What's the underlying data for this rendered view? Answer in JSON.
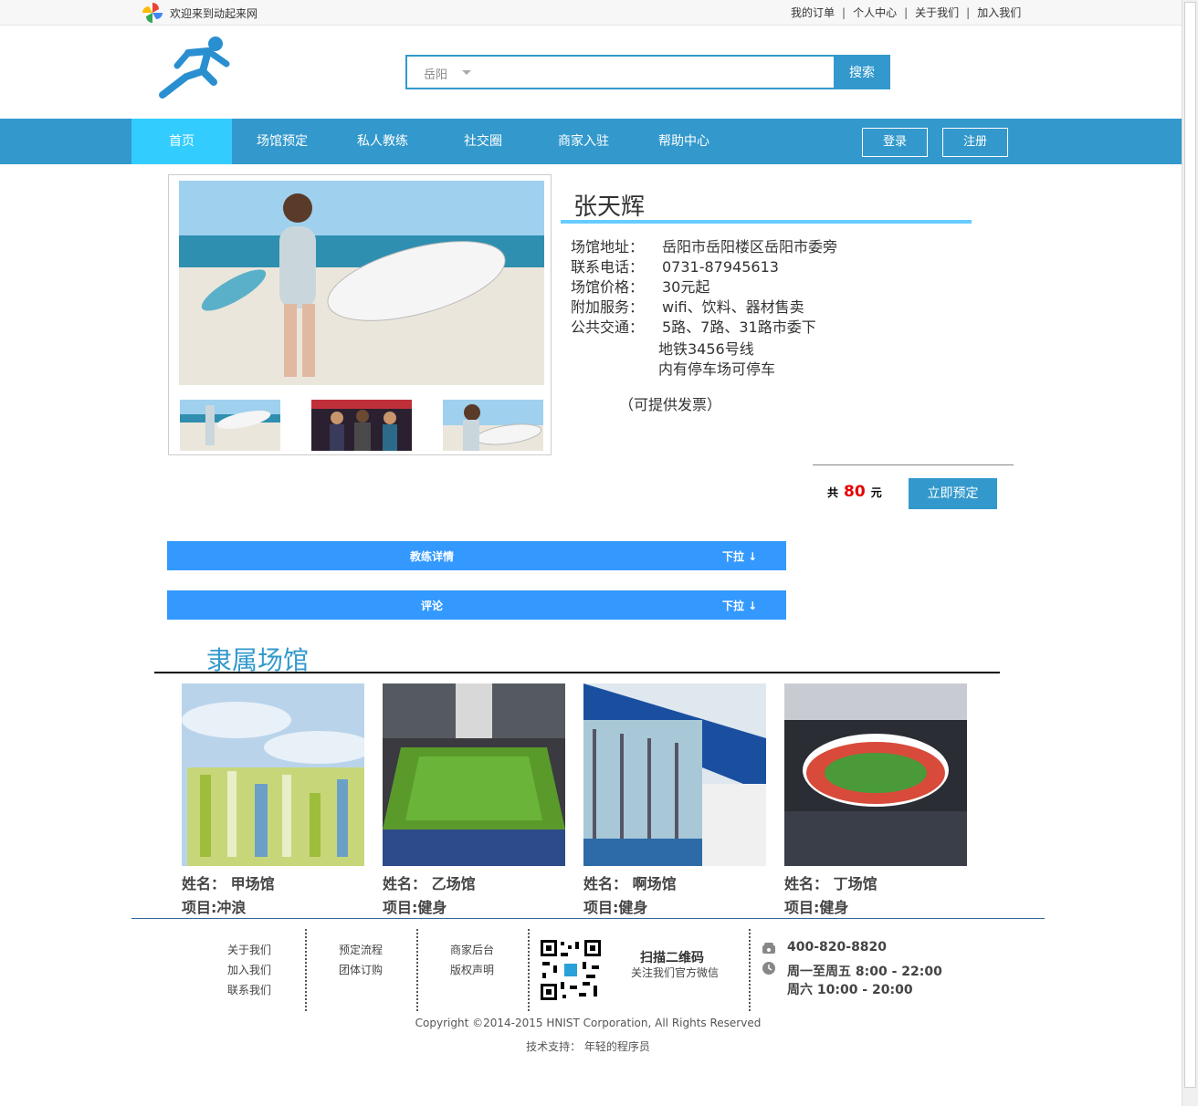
{
  "topbar": {
    "welcome": "欢迎来到动起来网",
    "links": [
      "我的订单",
      "个人中心",
      "关于我们",
      "加入我们"
    ],
    "separator": "|"
  },
  "search": {
    "city": "岳阳",
    "placeholder": "",
    "button": "搜索"
  },
  "nav": {
    "items": [
      "首页",
      "场馆预定",
      "私人教练",
      "社交圈",
      "商家入驻",
      "帮助中心"
    ],
    "login": "登录",
    "register": "注册"
  },
  "coach": {
    "name": "张天辉",
    "rows": [
      {
        "k": "场馆地址：",
        "v": "岳阳市岳阳楼区岳阳市委旁"
      },
      {
        "k": "联系电话：",
        "v": "0731-87945613"
      },
      {
        "k": "场馆价格：",
        "v": "30元起"
      },
      {
        "k": "附加服务：",
        "v": "wifi、饮料、器材售卖"
      },
      {
        "k": "公共交通：",
        "v": "5路、7路、31路市委下"
      }
    ],
    "transport_extra": [
      "地铁3456号线",
      "内有停车场可停车"
    ],
    "invoice": "（可提供发票）"
  },
  "order": {
    "prefix": "共",
    "amount": "80",
    "unit": "元",
    "book": "立即预定"
  },
  "accordions": [
    {
      "title": "教练详情",
      "toggle": "下拉 ↓"
    },
    {
      "title": "评论",
      "toggle": "下拉 ↓"
    }
  ],
  "venues": {
    "title": "隶属场馆",
    "items": [
      {
        "name": "姓名：  甲场馆",
        "project": "项目:冲浪"
      },
      {
        "name": "姓名：  乙场馆",
        "project": "项目:健身"
      },
      {
        "name": "姓名：  啊场馆",
        "project": "项目:健身"
      },
      {
        "name": "姓名：  丁场馆",
        "project": "项目:健身"
      }
    ]
  },
  "footer": {
    "col1": [
      "关于我们",
      "加入我们",
      "联系我们"
    ],
    "col2": [
      "预定流程",
      "团体订购"
    ],
    "col3": [
      "商家后台",
      "版权声明"
    ],
    "scan_title": "扫描二维码",
    "scan_sub": "关注我们官方微信",
    "phone": "400-820-8820",
    "hours1": "周一至周五  8:00 - 22:00",
    "hours2": "周六  10:00 - 20:00",
    "copyright": "Copyright ©2014-2015 HNIST Corporation, All Rights Reserved",
    "support": "技术支持：   年轻的程序员"
  },
  "colors": {
    "brand": "#3399cc",
    "nav_active": "#33ccff",
    "accordion": "#3399ff",
    "price": "#e60000"
  }
}
